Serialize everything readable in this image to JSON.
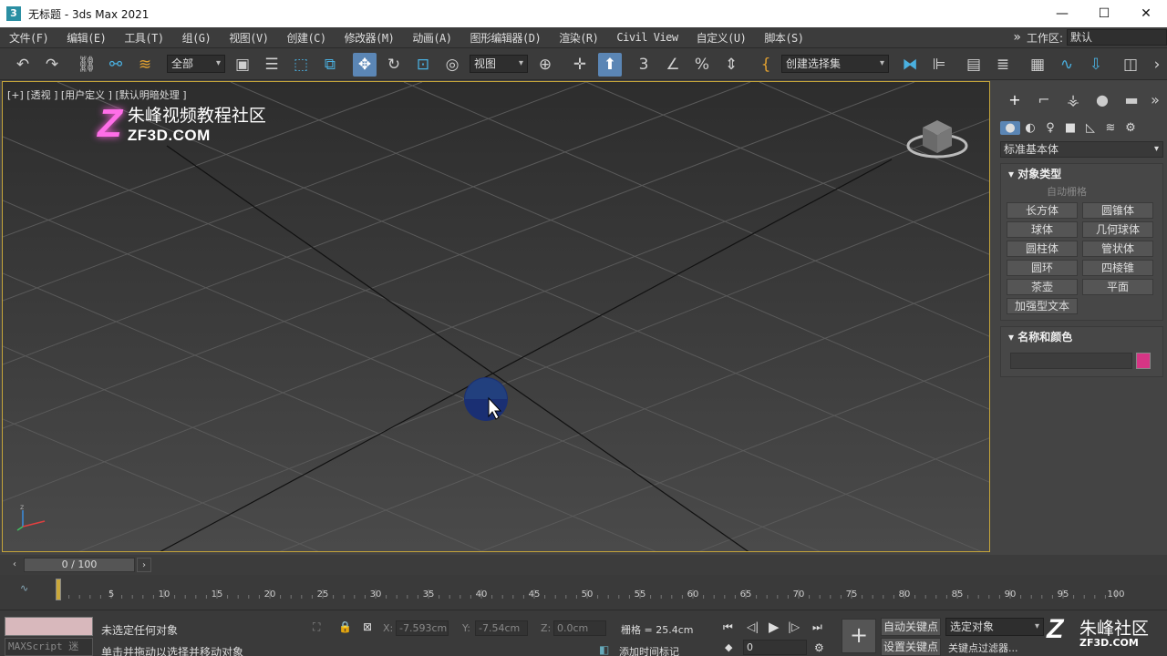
{
  "window": {
    "title": "无标题 - 3ds Max 2021",
    "app_icon": "3",
    "minimize": "—",
    "maximize": "☐",
    "close": "✕"
  },
  "menu": {
    "items": [
      "文件(F)",
      "编辑(E)",
      "工具(T)",
      "组(G)",
      "视图(V)",
      "创建(C)",
      "修改器(M)",
      "动画(A)",
      "图形编辑器(D)",
      "渲染(R)",
      "Civil View",
      "自定义(U)",
      "脚本(S)"
    ],
    "overflow": "»",
    "workspace_label": "工作区:",
    "workspace_value": "默认"
  },
  "toolbar": {
    "selection_filter": "全部",
    "ref_coord": "视图",
    "named_selection": "创建选择集"
  },
  "viewport": {
    "label": "[+] [透视 ] [用户定义 ] [默认明暗处理 ]",
    "watermark_cn": "朱峰视频教程社区",
    "watermark_en": "ZF3D.COM"
  },
  "command_panel": {
    "category": "标准基本体",
    "object_type_title": "对象类型",
    "autogrid": "自动栅格",
    "buttons": [
      "长方体",
      "圆锥体",
      "球体",
      "几何球体",
      "圆柱体",
      "管状体",
      "圆环",
      "四棱锥",
      "茶壶",
      "平面",
      "加强型文本"
    ],
    "name_color_title": "名称和颜色",
    "object_color": "#d63585"
  },
  "timeline": {
    "slider": "0 / 100",
    "ticks": [
      "0",
      "5",
      "10",
      "15",
      "20",
      "25",
      "30",
      "35",
      "40",
      "45",
      "50",
      "55",
      "60",
      "65",
      "70",
      "75",
      "80",
      "85",
      "90",
      "95",
      "100"
    ]
  },
  "status": {
    "maxscript": "MAXScript 迷",
    "selection": "未选定任何对象",
    "prompt": "单击并拖动以选择并移动对象",
    "x_label": "X:",
    "x_value": "-7.593cm",
    "y_label": "Y:",
    "y_value": "-7.54cm",
    "z_label": "Z:",
    "z_value": "0.0cm",
    "grid": "栅格 = 25.4cm",
    "add_time_tag": "添加时间标记",
    "auto_key": "自动关键点",
    "key_mode": "选定对象",
    "set_key": "设置关键点",
    "key_filters": "关键点过滤器...",
    "frame": "0",
    "brand": "朱峰社区",
    "brand_url": "ZF3D.COM"
  }
}
